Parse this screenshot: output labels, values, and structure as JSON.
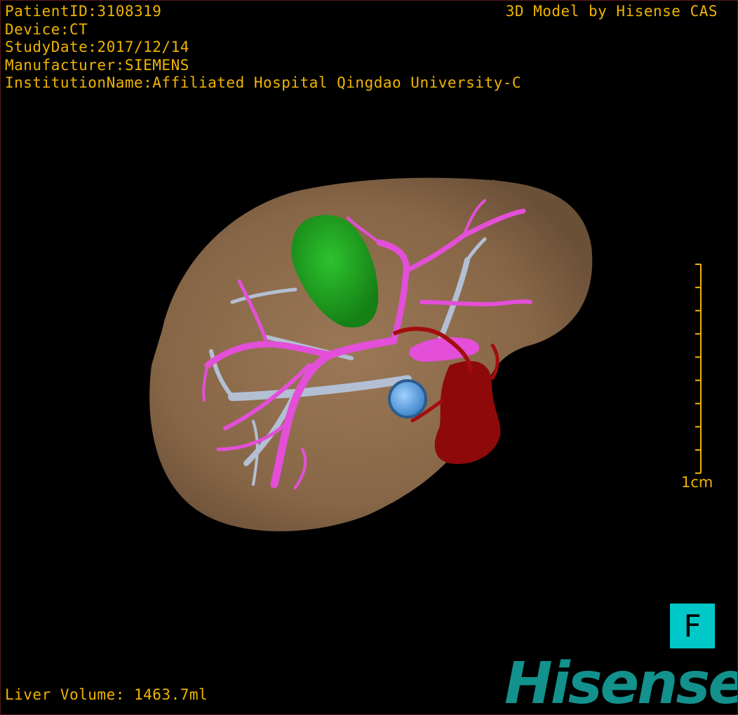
{
  "study_info": {
    "patient_id": "PatientID:3108319",
    "device": "Device:CT",
    "study_date": "StudyDate:2017/12/14",
    "manufacturer": "Manufacturer:SIEMENS",
    "institution": "InstitutionName:Affiliated Hospital Qingdao University-C"
  },
  "credit": "3D Model by Hisense CAS",
  "liver_volume": "Liver Volume: 1463.7ml",
  "scale": {
    "label": "1cm",
    "divisions": 9
  },
  "view_orientation": "F",
  "brand": "Hisense",
  "structures": [
    {
      "name": "liver",
      "color": "#8a6a48"
    },
    {
      "name": "lesion",
      "color": "#1fa81f"
    },
    {
      "name": "hepatic-vein",
      "color": "#e34fd8"
    },
    {
      "name": "portal-vein",
      "color": "#b3bfd3"
    },
    {
      "name": "hepatic-artery-ivc",
      "color": "#a30d0d"
    },
    {
      "name": "blue-marker",
      "color": "#6fb1f5"
    }
  ],
  "colors": {
    "overlay_text": "#f0b400",
    "background": "#000000",
    "badge_bg": "#00c8c8",
    "brand": "#13918c"
  }
}
